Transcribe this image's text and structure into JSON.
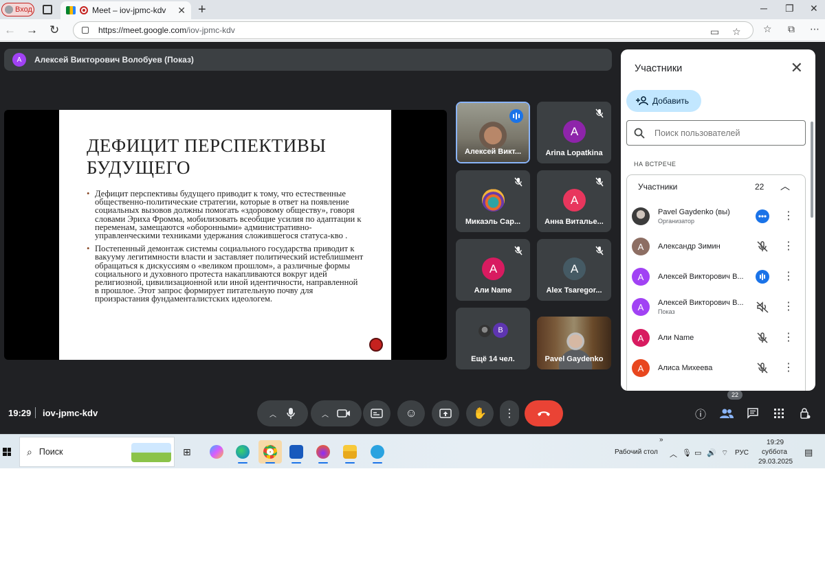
{
  "browser": {
    "profile_label": "Вход",
    "tab_title": "Meet – iov-jpmc-kdv",
    "url_prefix": "https://",
    "url_domain": "meet.google.com",
    "url_path": "/iov-jpmc-kdv"
  },
  "meet": {
    "presenter_initial": "А",
    "presenter_bar": "Алексей Викторович Волобуев (Показ)",
    "slide": {
      "title": "ДЕФИЦИТ ПЕРСПЕКТИВЫ БУДУЩЕГО",
      "bullets": [
        "Дефицит перспективы будущего приводит к тому, что естественные общественно-политические стратегии, которые в ответ на появление социальных вызовов должны помогать «здоровому обществу», говоря словами Эриха Фромма, мобилизовать всеобщие усилия по адаптации к переменам, замещаются «оборонными» административно-управленческими техниками удержания сложившегося статуса-кво .",
        "Постепенный демонтаж системы социального государства приводит к вакууму легитимности власти и заставляет политический истеблишмент обращаться к дискуссиям о «великом прошлом», а различные формы социального и духовного протеста накапливаются вокруг идей религиозной, цивилизационной или иной идентичности, направленной в прошлое. Этот запрос формирует питательную почву для произрастания фундаменталистских идеологем."
      ]
    },
    "tiles": [
      {
        "name": "Алексей Викт...",
        "initial": "",
        "color": ""
      },
      {
        "name": "Arina Lopatkina",
        "initial": "A",
        "color": "#8e24aa"
      },
      {
        "name": "Микаэль Сар...",
        "initial": "",
        "color": ""
      },
      {
        "name": "Анна Виталье...",
        "initial": "А",
        "color": "#e8365d"
      },
      {
        "name": "Али Name",
        "initial": "А",
        "color": "#d81b60"
      },
      {
        "name": "Alex Tsaregor...",
        "initial": "A",
        "color": "#455a64"
      },
      {
        "name": "Ещё 14 чел.",
        "initial": "В",
        "color": "#5e35b1"
      },
      {
        "name": "Pavel Gaydenko",
        "initial": "",
        "color": ""
      }
    ],
    "time": "19:29",
    "meeting_code": "iov-jpmc-kdv",
    "people_badge": "22"
  },
  "panel": {
    "title": "Участники",
    "add_label": "Добавить",
    "search_placeholder": "Поиск пользователей",
    "section_label": "НА ВСТРЕЧЕ",
    "group_label": "Участники",
    "group_count": "22",
    "people": [
      {
        "name": "Pavel Gaydenko (вы)",
        "sub": "Организатор",
        "initial": "",
        "color": "#4a4a4a",
        "state": "dots"
      },
      {
        "name": "Александр Зимин",
        "sub": "",
        "initial": "А",
        "color": "#8d6e63",
        "state": "muted"
      },
      {
        "name": "Алексей Викторович В...",
        "sub": "",
        "initial": "А",
        "color": "#a142f4",
        "state": "speaking"
      },
      {
        "name": "Алексей Викторович В...",
        "sub": "Показ",
        "initial": "А",
        "color": "#a142f4",
        "state": "sound-off"
      },
      {
        "name": "Али Name",
        "sub": "",
        "initial": "А",
        "color": "#d81b60",
        "state": "muted"
      },
      {
        "name": "Алиса Михеева",
        "sub": "",
        "initial": "А",
        "color": "#e8471f",
        "state": "muted"
      }
    ]
  },
  "taskbar": {
    "search_label": "Поиск",
    "desktop_label": "Рабочий стол",
    "lang": "РУС",
    "time": "19:29",
    "weekday": "суббота",
    "date": "29.03.2025"
  }
}
